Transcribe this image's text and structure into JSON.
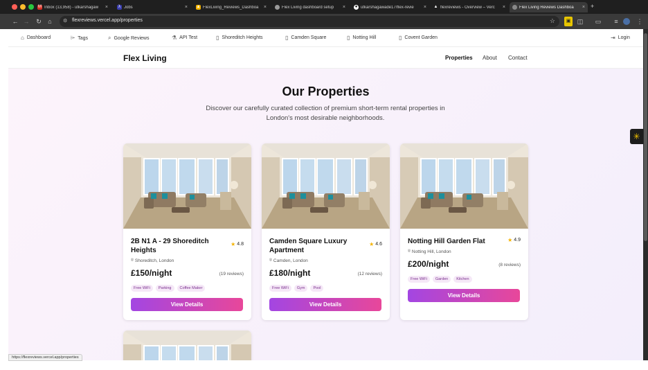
{
  "browser": {
    "tabs": [
      {
        "title": "Inbox (13,958) - utkarshagaw",
        "icon": "gmail-icon"
      },
      {
        "title": "Jobs",
        "icon": "jobs-icon"
      },
      {
        "title": "FlexLiving_Reviews_Dashboa",
        "icon": "drive-icon"
      },
      {
        "title": "Flex Living dashboard setup",
        "icon": "chat-icon"
      },
      {
        "title": "utkarshagawade17/flex-revie",
        "icon": "github-icon"
      },
      {
        "title": "flexreviews - Overview – Verc",
        "icon": "vercel-icon"
      },
      {
        "title": "Flex Living Reviews Dashboa",
        "icon": "globe-icon"
      }
    ],
    "url": "flexreviews.vercel.app/properties",
    "status_url": "https://flexreviews.vercel.app/properties"
  },
  "topnav": {
    "items": [
      {
        "label": "Dashboard",
        "icon": "home-icon"
      },
      {
        "label": "Tags",
        "icon": "tag-icon"
      },
      {
        "label": "Google Reviews",
        "icon": "search-icon"
      },
      {
        "label": "API Test",
        "icon": "flask-icon"
      },
      {
        "label": "Shoreditch Heights",
        "icon": "building-icon"
      },
      {
        "label": "Camden Square",
        "icon": "building-icon"
      },
      {
        "label": "Notting Hill",
        "icon": "building-icon"
      },
      {
        "label": "Covent Garden",
        "icon": "building-icon"
      }
    ],
    "login": "Login"
  },
  "header": {
    "brand": "Flex Living",
    "links": [
      "Properties",
      "About",
      "Contact"
    ],
    "active_link": "Properties"
  },
  "hero": {
    "title": "Our Properties",
    "subtitle": "Discover our carefully curated collection of premium short-term rental properties in London's most desirable neighborhoods."
  },
  "properties": [
    {
      "title": "2B N1 A - 29 Shoreditch Heights",
      "rating": "4.8",
      "location": "Shoreditch, London",
      "price": "£150/night",
      "reviews": "(19 reviews)",
      "amenities": [
        "Free WiFi",
        "Parking",
        "Coffee Maker"
      ],
      "button": "View Details"
    },
    {
      "title": "Camden Square Luxury Apartment",
      "rating": "4.6",
      "location": "Camden, London",
      "price": "£180/night",
      "reviews": "(12 reviews)",
      "amenities": [
        "Free WiFi",
        "Gym",
        "Pool"
      ],
      "button": "View Details"
    },
    {
      "title": "Notting Hill Garden Flat",
      "rating": "4.9",
      "location": "Notting Hill, London",
      "price": "£200/night",
      "reviews": "(8 reviews)",
      "amenities": [
        "Free WiFi",
        "Garden",
        "Kitchen"
      ],
      "button": "View Details"
    }
  ],
  "colors": {
    "accent_start": "#a346e2",
    "accent_end": "#e8479a",
    "star": "#f5b301",
    "tag_bg": "#f5e8f7",
    "tag_text": "#7a2e8e"
  }
}
